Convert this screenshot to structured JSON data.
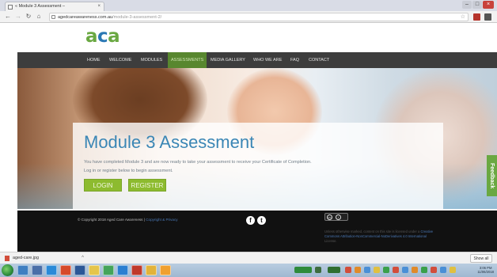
{
  "browser": {
    "tab_title": "« Module 3 Assessment – ",
    "tab_close": "×",
    "url_host": "agedcareawareness.com.au",
    "url_path": "/module-3-assessment-2/"
  },
  "site": {
    "logo": {
      "a1": "a",
      "c": "c",
      "a2": "a"
    },
    "nav": [
      {
        "label": "HOME"
      },
      {
        "label": "WELCOME"
      },
      {
        "label": "MODULES"
      },
      {
        "label": "ASSESSMENTS"
      },
      {
        "label": "MEDIA GALLERY"
      },
      {
        "label": "WHO WE ARE"
      },
      {
        "label": "FAQ"
      },
      {
        "label": "CONTACT"
      }
    ]
  },
  "card": {
    "title": "Module 3 Assessment",
    "line1": "You have completed Module 3 and are now ready to take your assessment to receive your Certificate of Completion.",
    "line2": "Log in or register below to begin assessment.",
    "login_label": "LOGIN",
    "register_label": "REGISTER"
  },
  "feedback_label": "Feedback",
  "footer": {
    "copyright": "© Copyright 2018 Aged Care Awareness | ",
    "copyright_link": "Copyright & Privacy",
    "license_line1": "Unless otherwise marked, content on this site is licensed",
    "license_line2": "under a ",
    "license_link": "Creative Commons Attribution-NonCommercial-NoDerivatives 4.0 International",
    "license_end": " License."
  },
  "downloads": {
    "file": "aged-care.jpg",
    "caret": "^",
    "show_all": "Show all"
  },
  "taskbar": {
    "time": "3:06 PM",
    "date": "11/06/2018"
  }
}
